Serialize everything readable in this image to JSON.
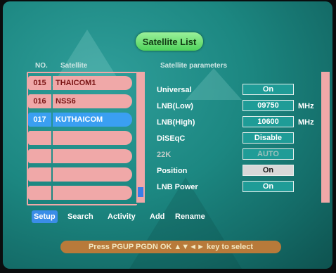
{
  "title": "Satellite List",
  "headers": {
    "no": "NO.",
    "satellite": "Satellite",
    "params": "Satellite parameters"
  },
  "satellites": [
    {
      "no": "015",
      "name": "THAICOM1",
      "selected": false
    },
    {
      "no": "016",
      "name": "NSS6",
      "selected": false
    },
    {
      "no": "017",
      "name": "KUTHAICOM",
      "selected": true
    },
    {
      "no": "",
      "name": "",
      "selected": false
    },
    {
      "no": "",
      "name": "",
      "selected": false
    },
    {
      "no": "",
      "name": "",
      "selected": false
    },
    {
      "no": "",
      "name": "",
      "selected": false
    }
  ],
  "params": [
    {
      "label": "Universal",
      "value": "On",
      "unit": ""
    },
    {
      "label": "LNB(Low)",
      "value": "09750",
      "unit": "MHz"
    },
    {
      "label": "LNB(High)",
      "value": "10600",
      "unit": "MHz"
    },
    {
      "label": "DiSEqC",
      "value": "Disable",
      "unit": ""
    },
    {
      "label": "22K",
      "value": "AUTO",
      "unit": ""
    },
    {
      "label": "Position",
      "value": "On",
      "unit": ""
    },
    {
      "label": "LNB Power",
      "value": "On",
      "unit": ""
    }
  ],
  "menu": [
    "Setup",
    "Search",
    "Activity",
    "Add",
    "Rename"
  ],
  "hint": "Press PGUP PGDN OK ▲▼◄► key to select",
  "colors": {
    "selected": "#3a9ff2",
    "row": "#f0a8a8",
    "accent": "#4fd35a",
    "hint_bg": "#b87a3a"
  }
}
